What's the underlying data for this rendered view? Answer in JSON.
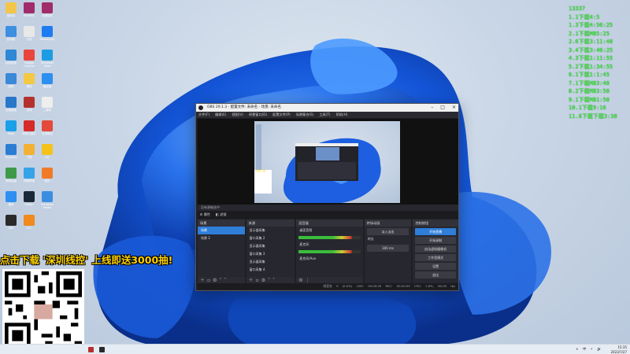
{
  "desktop": {
    "icons": [
      {
        "label": "回收站",
        "color": "#f3c64a"
      },
      {
        "label": "WinRAR",
        "color": "#a02c6b"
      },
      {
        "label": "压缩软件",
        "color": "#a02c6b"
      },
      {
        "label": "此电脑",
        "color": "#3d8fe0"
      },
      {
        "label": "文档",
        "color": "#e8e8e8"
      },
      {
        "label": "Messenger",
        "color": "#1e7cf2"
      },
      {
        "label": "控制面板",
        "color": "#2f88d6"
      },
      {
        "label": "Google Chrome",
        "color": "#e8453c"
      },
      {
        "label": "Microsoft Edge",
        "color": "#1d9be3"
      },
      {
        "label": "网络",
        "color": "#3a88d8"
      },
      {
        "label": "微信",
        "color": "#f3c843"
      },
      {
        "label": "播放器",
        "color": "#2d8ff0"
      },
      {
        "label": "远程桌面",
        "color": "#2877c9"
      },
      {
        "label": "游戏",
        "color": "#b4322e"
      },
      {
        "label": "二维码",
        "color": "#eeeeee"
      },
      {
        "label": "Edge",
        "color": "#1aa0e8"
      },
      {
        "label": "网易云音乐",
        "color": "#d62b2b"
      },
      {
        "label": "应用商店",
        "color": "#e34a3a"
      },
      {
        "label": "Windows",
        "color": "#2b7cd3"
      },
      {
        "label": "下载",
        "color": "#f2b134"
      },
      {
        "label": "QQ",
        "color": "#f5c21a"
      },
      {
        "label": "网络连接",
        "color": "#3e9a47"
      },
      {
        "label": "哔哩哔哩",
        "color": "#36a3e8"
      },
      {
        "label": "软件",
        "color": "#f07a28"
      },
      {
        "label": "播放",
        "color": "#2d8ff0"
      },
      {
        "label": "Steam",
        "color": "#1b2838"
      },
      {
        "label": "Windows Media",
        "color": "#3b8de0"
      },
      {
        "label": "OBS",
        "color": "#2a2a2a"
      },
      {
        "label": "VLC",
        "color": "#f08a1c"
      }
    ]
  },
  "overlay_list": [
    "13337",
    "1.1下载4:5",
    "1.3下载4:56:25",
    "2.1下载MB5:25",
    "2.6下载3:11:40",
    "3.4下载3:46:25",
    "4.3下载1:11:55",
    "5.2下载1:34:55",
    "6.1下载1:1:45",
    "7.1下载MB3:40",
    "8.2下载MB3:50",
    "9.1下载MB1:50",
    "10.1下载9:16",
    "11.8下载下载3:38"
  ],
  "ad": {
    "banner": "点击下载 '深圳线控' 上线即送3000抽!"
  },
  "obs": {
    "title": "OBS 29.1.3 - 配置文件: 未命名 - 场景: 未命名",
    "menu": [
      "文件(F)",
      "编辑(E)",
      "视图(V)",
      "停靠窗口(D)",
      "配置文件(P)",
      "场景集合(S)",
      "工具(T)",
      "帮助(H)"
    ],
    "scene_bar": "没有源被选中",
    "tabs": [
      "属性",
      "滤镜"
    ],
    "docks": {
      "scenes": {
        "title": "场景",
        "items": [
          "场景",
          "场景 2"
        ]
      },
      "sources": {
        "title": "来源",
        "items": [
          "显示器采集",
          "窗口采集 2",
          "显示器采集",
          "窗口采集 3",
          "显示器采集",
          "窗口采集 4",
          "图像 幻灯片"
        ]
      },
      "mixer": {
        "title": "混音器",
        "channels": [
          {
            "name": "桌面音频",
            "db": "0.0 dB"
          },
          {
            "name": "麦克风",
            "db": "0.0 dB"
          },
          {
            "name": "麦克风/Aux",
            "db": "0.0 dB"
          }
        ]
      },
      "transitions": {
        "title": "转场动画",
        "type": "淡入淡出",
        "duration_label": "时长",
        "duration": "300 ms"
      },
      "controls": {
        "title": "控制按钮",
        "buttons": [
          "开始直播",
          "开始录制",
          "启动虚拟摄像机",
          "工作室模式",
          "设置",
          "退出"
        ]
      }
    },
    "status": "帧丢失 0 (0.0%)   LIVE: 00:00:00   REC: 00:00:00   CPU: 1.8%, 60.00 fps"
  },
  "taskbar": {
    "tray": "∧ 中 ⚡ 🔊",
    "time": "15:35",
    "date": "2023/7/27"
  },
  "colors": {
    "accent": "#2f7ed8",
    "green_text": "#39ff39",
    "ad_yellow": "#ffd200"
  }
}
